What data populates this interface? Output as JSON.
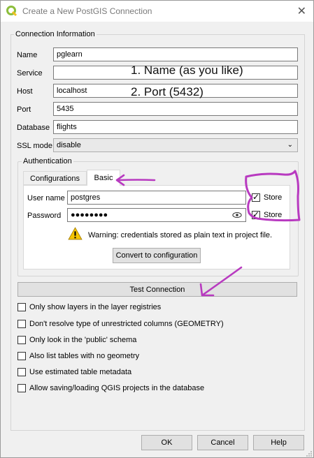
{
  "window": {
    "title": "Create a New PostGIS Connection",
    "close_glyph": "✕"
  },
  "connection": {
    "group_title": "Connection Information",
    "name_label": "Name",
    "name_value": "pglearn",
    "service_label": "Service",
    "service_value": "",
    "host_label": "Host",
    "host_value": "localhost",
    "port_label": "Port",
    "port_value": "5435",
    "database_label": "Database",
    "database_value": "flights",
    "sslmode_label": "SSL mode",
    "sslmode_value": "disable"
  },
  "auth": {
    "group_title": "Authentication",
    "tabs": [
      {
        "label": "Configurations",
        "active": false
      },
      {
        "label": "Basic",
        "active": true
      }
    ],
    "username_label": "User name",
    "username_value": "postgres",
    "password_label": "Password",
    "password_value": "●●●●●●●●",
    "store_label": "Store",
    "store_username_checked": true,
    "store_password_checked": true,
    "warning_text": "Warning: credentials stored as plain text in project file.",
    "convert_button": "Convert to configuration"
  },
  "test_button": "Test Connection",
  "options": [
    {
      "label": "Only show layers in the layer registries",
      "checked": false
    },
    {
      "label": "Don't resolve type of unrestricted columns (GEOMETRY)",
      "checked": false
    },
    {
      "label": "Only look in the 'public' schema",
      "checked": false
    },
    {
      "label": "Also list tables with no geometry",
      "checked": false
    },
    {
      "label": "Use estimated table metadata",
      "checked": false
    },
    {
      "label": "Allow saving/loading QGIS projects in the database",
      "checked": false
    }
  ],
  "footer": {
    "ok": "OK",
    "cancel": "Cancel",
    "help": "Help"
  },
  "annotations": {
    "note1": "1. Name (as you like)",
    "note2": "2. Port (5432)",
    "color": "#b83ac0"
  },
  "colors": {
    "qgis_green": "#8cbe3c",
    "warning_yellow": "#f5c400"
  }
}
